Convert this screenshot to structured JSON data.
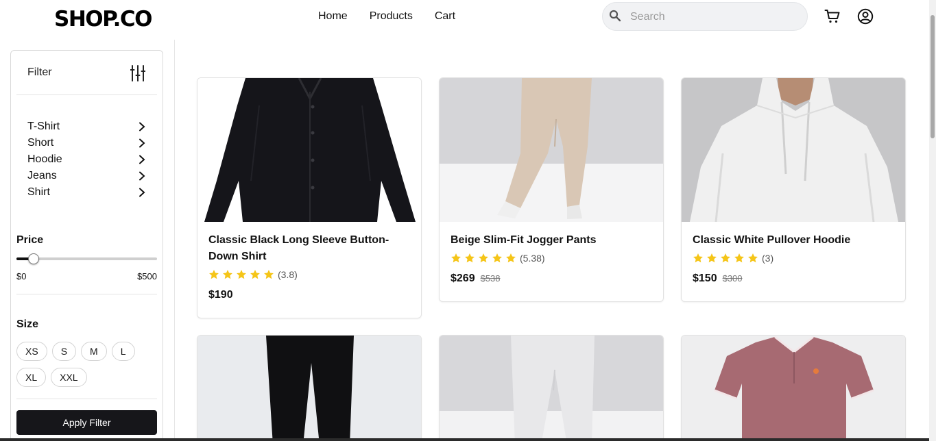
{
  "header": {
    "logo": "SHOP.CO",
    "nav": [
      "Home",
      "Products",
      "Cart"
    ],
    "search_placeholder": "Search",
    "cart_icon": "cart-icon",
    "account_icon": "user-circle-icon"
  },
  "sidebar": {
    "filter_title": "Filter",
    "filter_icon": "sliders-icon",
    "categories": [
      "T-Shirt",
      "Short",
      "Hoodie",
      "Jeans",
      "Shirt"
    ],
    "price": {
      "title": "Price",
      "min_label": "$0",
      "max_label": "$500",
      "selected_fraction": 0.12
    },
    "size": {
      "title": "Size",
      "options": [
        "XS",
        "S",
        "M",
        "L",
        "XL",
        "XXL"
      ]
    },
    "apply_label": "Apply Filter"
  },
  "products": [
    {
      "name": "Classic Black Long Sleeve Button-Down Shirt",
      "rating_text": "(3.8)",
      "stars": 5,
      "price": "$190",
      "old_price": ""
    },
    {
      "name": "Beige Slim-Fit Jogger Pants",
      "rating_text": "(5.38)",
      "stars": 5,
      "price": "$269",
      "old_price": "$538"
    },
    {
      "name": "Classic White Pullover Hoodie",
      "rating_text": "(3)",
      "stars": 5,
      "price": "$150",
      "old_price": "$300"
    }
  ],
  "colors": {
    "accent": "#16161a",
    "star": "#f5c518",
    "search_bg": "#f1f2f4"
  }
}
